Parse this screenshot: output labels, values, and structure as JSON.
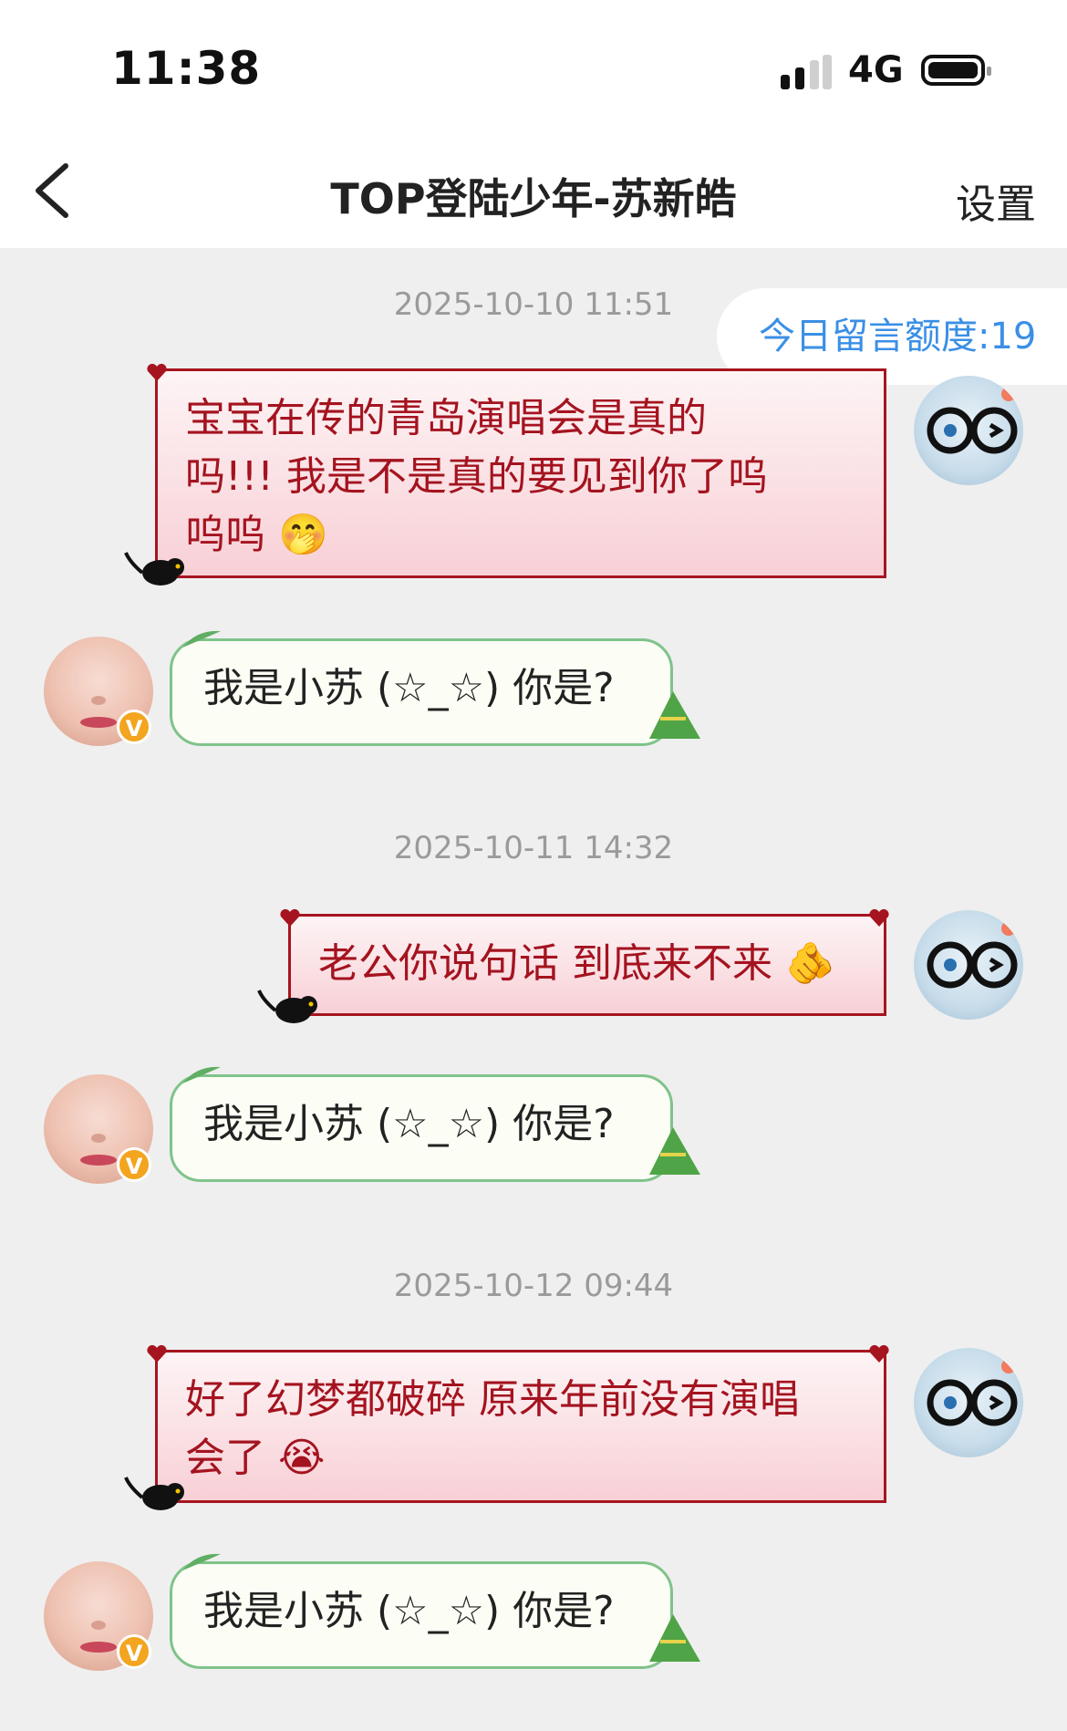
{
  "status": {
    "time": "11:38",
    "network": "4G"
  },
  "header": {
    "title": "TOP登陆少年-苏新皓",
    "settings": "设置"
  },
  "quota": "今日留言额度:19",
  "conversations": [
    {
      "timestamp": "2025-10-10 11:51",
      "outgoing": "宝宝在传的青岛演唱会是真的吗!!! 我是不是真的要见到你了呜呜呜",
      "outgoing_lines": [
        "宝宝在传的青岛演唱会是真的",
        "吗!!! 我是不是真的要见到你了呜",
        "呜呜"
      ],
      "outgoing_emoji": "🤭",
      "incoming": "我是小苏 (☆_☆) 你是?"
    },
    {
      "timestamp": "2025-10-11 14:32",
      "outgoing": "老公你说句话 到底来不来",
      "outgoing_lines": [
        "老公你说句话 到底来不来"
      ],
      "outgoing_emoji": "🫵",
      "incoming": "我是小苏 (☆_☆) 你是?"
    },
    {
      "timestamp": "2025-10-12 09:44",
      "outgoing": "好了幻梦都破碎 原来年前没有演唱会了",
      "outgoing_lines": [
        "好了幻梦都破碎 原来年前没有演唱",
        "会了"
      ],
      "outgoing_emoji": "😭",
      "incoming": "我是小苏 (☆_☆) 你是?"
    }
  ],
  "badges": {
    "verified": "V"
  },
  "colors": {
    "outgoing_text": "#a4131f",
    "outgoing_border": "#a6151f",
    "incoming_border": "#7fc38a",
    "quota_text": "#3b8fe6",
    "timestamp": "#9a9a9a"
  },
  "icons": {
    "back": "chevron-left-icon",
    "signal": "cellular-signal-icon",
    "battery": "battery-icon"
  }
}
